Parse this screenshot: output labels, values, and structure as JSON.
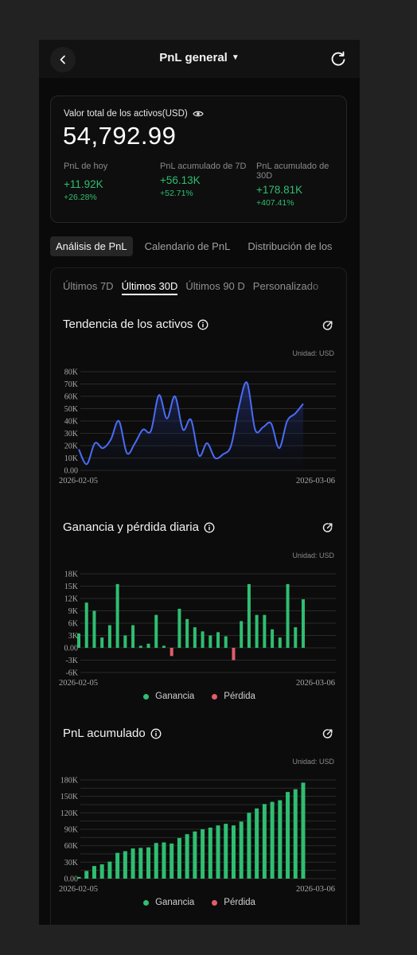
{
  "header": {
    "title": "PnL general"
  },
  "summary": {
    "total_label": "Valor total de los activos(USD)",
    "total_value": "54,792.99",
    "stats": [
      {
        "label": "PnL de hoy",
        "value": "+11.92K",
        "pct": "+26.28%"
      },
      {
        "label": "PnL acumulado de 7D",
        "value": "+56.13K",
        "pct": "+52.71%"
      },
      {
        "label": "PnL acumulado de 30D",
        "value": "+178.81K",
        "pct": "+407.41%"
      }
    ]
  },
  "main_tabs": [
    {
      "label": "Análisis de PnL",
      "active": true
    },
    {
      "label": "Calendario de PnL",
      "active": false
    },
    {
      "label": "Distribución de los",
      "active": false
    }
  ],
  "period_tabs": [
    {
      "label": "Últimos 7D",
      "active": false
    },
    {
      "label": "Últimos 30D",
      "active": true
    },
    {
      "label": "Últimos 90 D",
      "active": false
    },
    {
      "label": "Personalizado",
      "active": false
    }
  ],
  "sections": {
    "trend": {
      "title": "Tendencia de los activos",
      "unit": "Unidad: USD"
    },
    "daily": {
      "title": "Ganancia y pérdida diaria",
      "unit": "Unidad: USD"
    },
    "cumulative": {
      "title": "PnL acumulado",
      "unit": "Unidad: USD"
    }
  },
  "legend": {
    "gain": "Ganancia",
    "loss": "Pérdida"
  },
  "colors": {
    "gain": "#2fbe71",
    "loss": "#e05d6a",
    "line": "#4a6cf7",
    "grid": "#2a2a2a",
    "axis_text": "#a8a8a8"
  },
  "chart_data": [
    {
      "type": "area",
      "x_start": "2026-02-05",
      "x_end": "2026-03-06",
      "y_ticks": [
        "0.00",
        "10K",
        "20K",
        "30K",
        "40K",
        "50K",
        "60K",
        "70K",
        "80K"
      ],
      "ylim": [
        0,
        80000
      ],
      "values": [
        17000,
        5000,
        22000,
        18000,
        25000,
        40000,
        14000,
        22000,
        33000,
        32000,
        61000,
        42000,
        60000,
        33000,
        41000,
        12000,
        22000,
        10000,
        13000,
        20000,
        52000,
        71000,
        33000,
        35000,
        38000,
        18000,
        40000,
        46000,
        54000
      ]
    },
    {
      "type": "bar",
      "x_start": "2026-02-05",
      "x_end": "2026-03-06",
      "y_ticks": [
        "-6K",
        "-3K",
        "0.00",
        "3K",
        "6K",
        "9K",
        "12K",
        "15K",
        "18K"
      ],
      "ylim": [
        -6000,
        18000
      ],
      "values": [
        3500,
        11000,
        9000,
        2500,
        5500,
        15500,
        3000,
        5500,
        500,
        1000,
        8000,
        500,
        -2000,
        9500,
        7000,
        5000,
        4000,
        3000,
        3800,
        2800,
        -3000,
        6500,
        15500,
        8000,
        8000,
        4500,
        2500,
        15500,
        5000,
        11800
      ]
    },
    {
      "type": "bar",
      "x_start": "2026-02-05",
      "x_end": "2026-03-06",
      "y_ticks": [
        "0.00",
        "15K",
        "30K",
        "45K",
        "60K",
        "75K",
        "90K",
        "105K",
        "120K",
        "135K",
        "150K",
        "165K",
        "180K"
      ],
      "y_ticks_shown": [
        "0.00",
        "30K",
        "60K",
        "90K",
        "120K",
        "150K",
        "180K"
      ],
      "ylim": [
        0,
        180000
      ],
      "values": [
        3000,
        14000,
        23000,
        26000,
        31000,
        47000,
        50000,
        55000,
        56000,
        57000,
        65000,
        66000,
        64000,
        74000,
        81000,
        86000,
        90000,
        93000,
        97000,
        100000,
        97000,
        104000,
        120000,
        128000,
        136000,
        140000,
        143000,
        158000,
        163000,
        175000
      ]
    }
  ]
}
